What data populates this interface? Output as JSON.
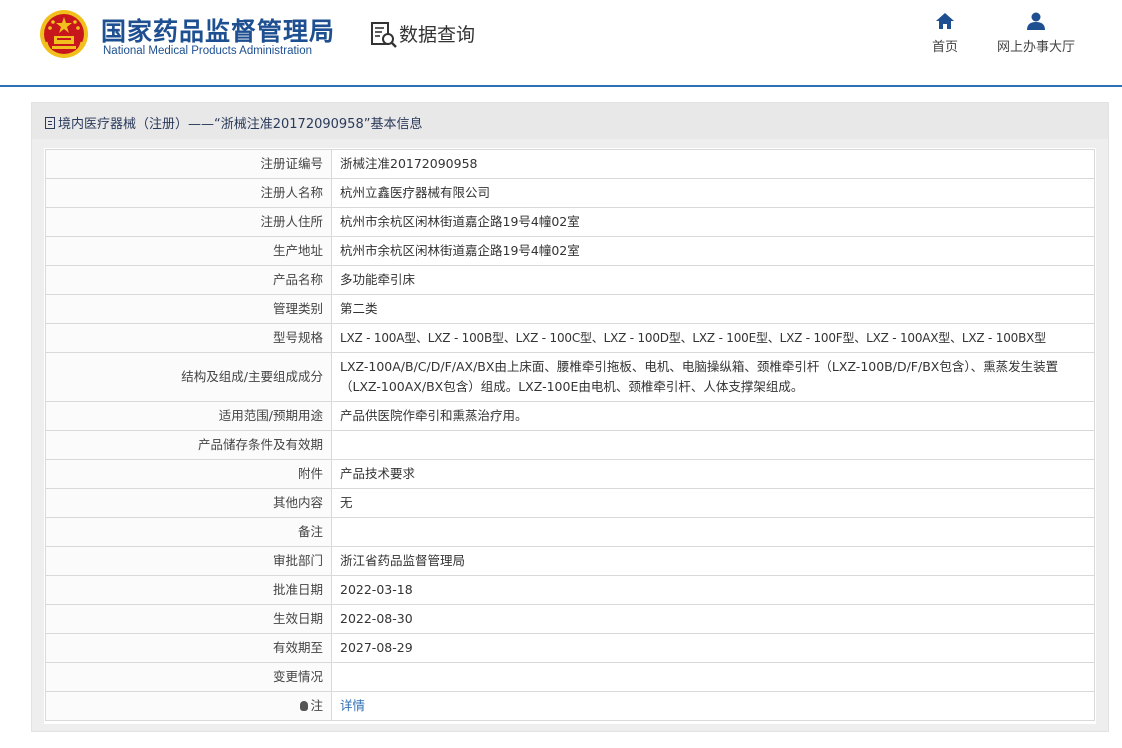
{
  "header": {
    "site_title": "国家药品监督管理局",
    "site_subtitle": "National Medical Products Administration",
    "section_title": "数据查询",
    "nav": {
      "home": "首页",
      "online_hall": "网上办事大厅"
    }
  },
  "icons": {
    "emblem": "national-emblem-icon",
    "query": "document-search-icon",
    "home": "home-icon",
    "user": "user-icon",
    "doc": "document-icon",
    "bulb": "lightbulb-icon"
  },
  "colors": {
    "brand_blue": "#1d4f91",
    "link_blue": "#2f6fb4",
    "emblem_red": "#c8161d",
    "emblem_gold": "#f2c01c"
  },
  "panel": {
    "title": "境内医疗器械（注册）——“浙械注准20172090958”基本信息"
  },
  "rows": [
    {
      "label": "注册证编号",
      "value": "浙械注准20172090958"
    },
    {
      "label": "注册人名称",
      "value": "杭州立鑫医疗器械有限公司"
    },
    {
      "label": "注册人住所",
      "value": "杭州市余杭区闲林街道嘉企路19号4幢02室"
    },
    {
      "label": "生产地址",
      "value": "杭州市余杭区闲林街道嘉企路19号4幢02室"
    },
    {
      "label": "产品名称",
      "value": "多功能牵引床"
    },
    {
      "label": "管理类别",
      "value": "第二类"
    },
    {
      "label": "型号规格",
      "value": "LXZ - 100A型、LXZ - 100B型、LXZ - 100C型、LXZ - 100D型、LXZ - 100E型、LXZ - 100F型、LXZ - 100AX型、LXZ - 100BX型"
    },
    {
      "label": "结构及组成/主要组成成分",
      "value": "LXZ-100A/B/C/D/F/AX/BX由上床面、腰椎牵引拖板、电机、电脑操纵箱、颈椎牵引杆（LXZ-100B/D/F/BX包含）、熏蒸发生装置（LXZ-100AX/BX包含）组成。LXZ-100E由电机、颈椎牵引杆、人体支撑架组成。"
    },
    {
      "label": "适用范围/预期用途",
      "value": "产品供医院作牵引和熏蒸治疗用。"
    },
    {
      "label": "产品储存条件及有效期",
      "value": ""
    },
    {
      "label": "附件",
      "value": "产品技术要求"
    },
    {
      "label": "其他内容",
      "value": "无"
    },
    {
      "label": "备注",
      "value": ""
    },
    {
      "label": "审批部门",
      "value": "浙江省药品监督管理局"
    },
    {
      "label": "批准日期",
      "value": "2022-03-18"
    },
    {
      "label": "生效日期",
      "value": "2022-08-30"
    },
    {
      "label": "有效期至",
      "value": "2027-08-29"
    },
    {
      "label": "变更情况",
      "value": ""
    },
    {
      "label": "注",
      "value": "详情"
    }
  ]
}
